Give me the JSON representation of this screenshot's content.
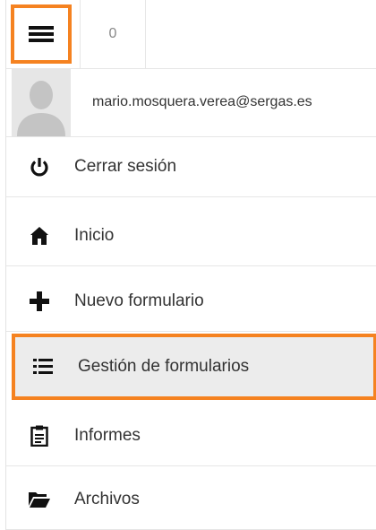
{
  "topbar": {
    "counter": "0"
  },
  "user": {
    "email": "mario.mosquera.verea@sergas.es"
  },
  "menu": {
    "items": [
      {
        "label": "Cerrar sesión",
        "icon": "power-icon"
      },
      {
        "label": "Inicio",
        "icon": "home-icon"
      },
      {
        "label": "Nuevo formulario",
        "icon": "plus-icon"
      },
      {
        "label": "Gestión de formularios",
        "icon": "list-icon",
        "active": true
      },
      {
        "label": "Informes",
        "icon": "clipboard-icon"
      },
      {
        "label": "Archivos",
        "icon": "folder-open-icon"
      }
    ]
  },
  "colors": {
    "highlight": "#f58220",
    "active_bg": "#ececec"
  }
}
